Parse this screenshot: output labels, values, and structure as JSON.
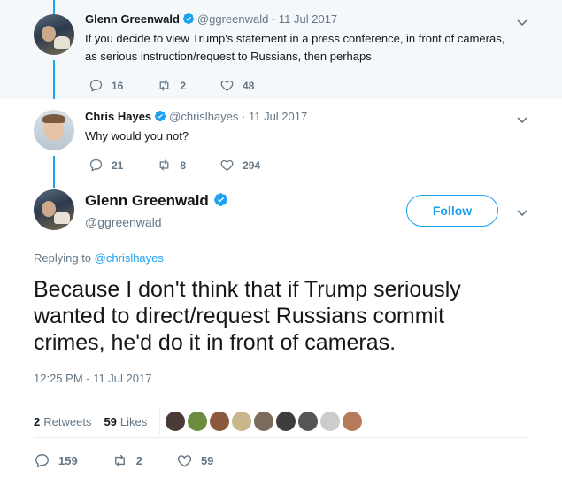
{
  "tweet1": {
    "name": "Glenn Greenwald",
    "handle": "@ggreenwald",
    "date": "· 11 Jul 2017",
    "text_line1": "If you decide to view Trump's statement in a press conference, in front of cameras,",
    "text_line2": "as serious instruction/request to Russians, then perhaps",
    "replies": "16",
    "retweets": "2",
    "likes": "48"
  },
  "tweet2": {
    "name": "Chris Hayes",
    "handle": "@chrislhayes",
    "date": "· 11 Jul 2017",
    "text": "Why would you not?",
    "replies": "21",
    "retweets": "8",
    "likes": "294"
  },
  "main_tweet": {
    "name": "Glenn Greenwald",
    "handle": "@ggreenwald",
    "follow_label": "Follow",
    "replying_prefix": "Replying to",
    "replying_to": "@chrislhayes",
    "text_line1": "Because I don't think that if Trump seriously",
    "text_line2": "wanted to direct/request Russians commit",
    "text_line3": "crimes, he'd do it in front of cameras.",
    "timestamp": "12:25 PM - 11 Jul 2017",
    "retweet_count": "2",
    "retweet_label": "Retweets",
    "like_count": "59",
    "like_label": "Likes",
    "replies": "159",
    "retweets": "2",
    "likes": "59"
  },
  "colors": {
    "accent": "#1da1f2",
    "muted": "#657786",
    "thread_bg": "#f5f8fa"
  },
  "liker_avatars": [
    "#4a3a35",
    "#6b8c3e",
    "#8a5a3c",
    "#c9b78a",
    "#7c6a5a",
    "#3d3d3d",
    "#555555",
    "#cccccc",
    "#b57a5c"
  ]
}
